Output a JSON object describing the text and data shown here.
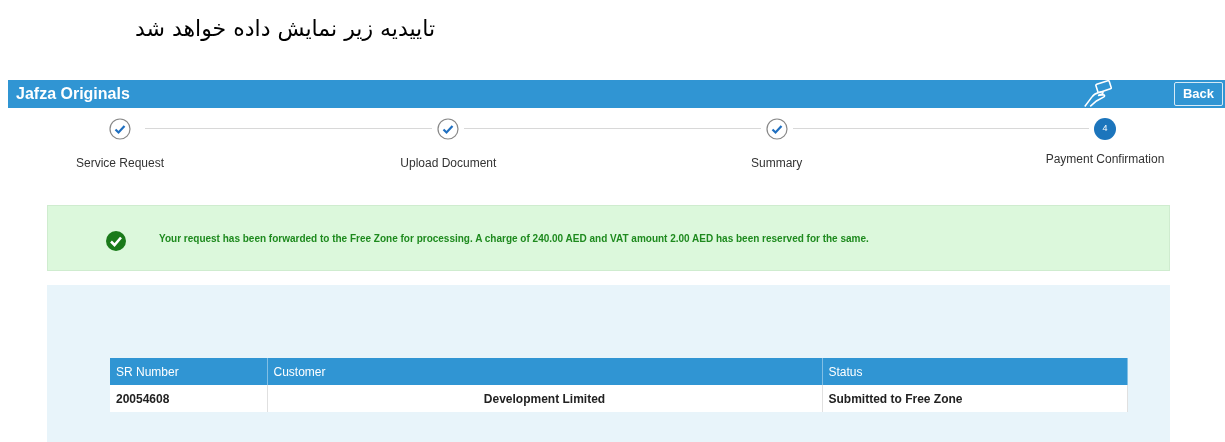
{
  "caption": "تاییدیه زیر نمایش داده خواهد شد",
  "header": {
    "title": "Jafza Originals",
    "back_button": "Back"
  },
  "steps": [
    {
      "label": "Service Request",
      "completed": true
    },
    {
      "label": "Upload Document",
      "completed": true
    },
    {
      "label": "Summary",
      "completed": true
    },
    {
      "label": "Payment Confirmation",
      "completed": false,
      "number": "4"
    }
  ],
  "alert": {
    "message": "Your request has been forwarded to the Free Zone for processing. A charge of 240.00 AED and VAT amount 2.00 AED has been reserved for the same."
  },
  "table": {
    "columns": [
      "SR Number",
      "Customer",
      "Status"
    ],
    "rows": [
      [
        "20054608",
        "Development Limited",
        "Submitted to Free Zone"
      ]
    ]
  }
}
